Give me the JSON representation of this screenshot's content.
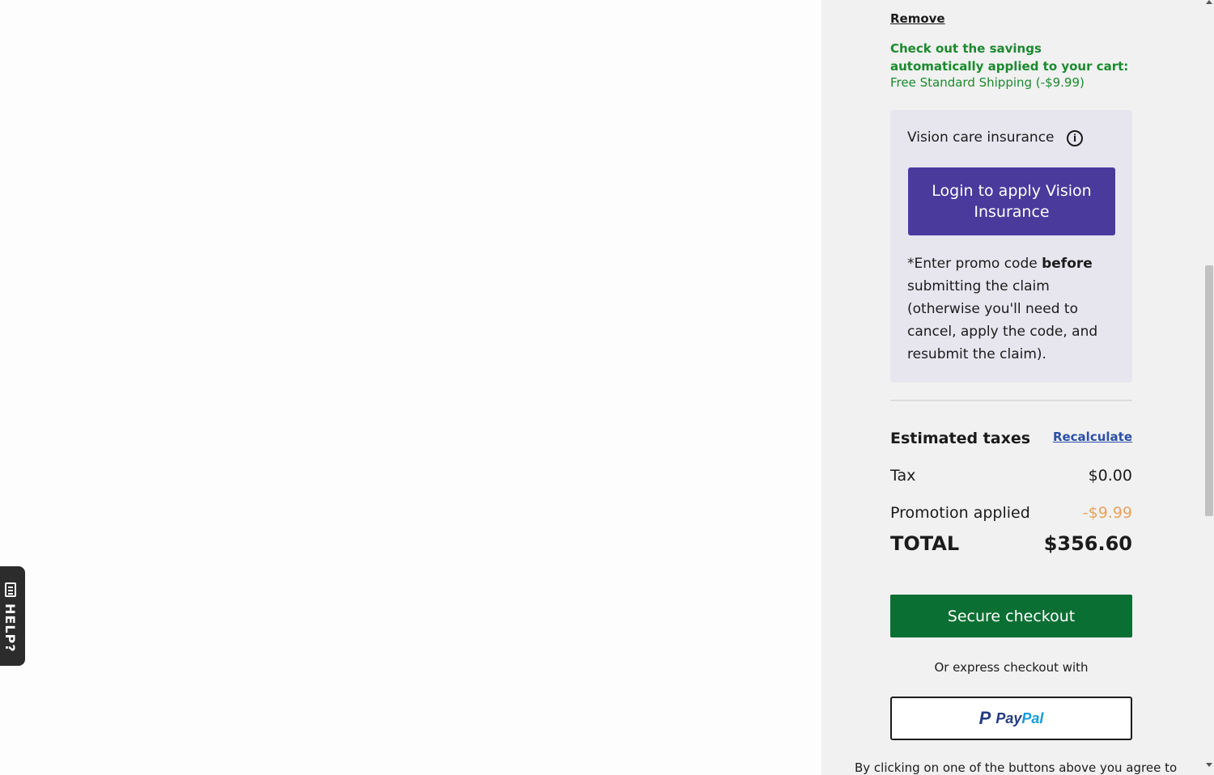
{
  "help_tab": {
    "label": "HELP?"
  },
  "cart_summary": {
    "remove_label": "Remove",
    "savings": {
      "title": "Check out the savings automatically applied to your cart:",
      "item": "Free Standard Shipping (-$9.99)"
    },
    "vision_insurance": {
      "title": "Vision care insurance",
      "login_button": "Login to apply Vision Insurance",
      "note_prefix": "*Enter promo code ",
      "note_bold": "before",
      "note_suffix": " submitting the claim (otherwise you'll need to cancel, apply the code, and resubmit the claim)."
    },
    "taxes": {
      "heading": "Estimated taxes",
      "recalculate_label": "Recalculate",
      "tax_label": "Tax",
      "tax_value": "$0.00",
      "promotion_label": "Promotion applied",
      "promotion_value": "-$9.99",
      "total_label": "TOTAL",
      "total_value": "$356.60"
    },
    "checkout": {
      "secure_checkout_label": "Secure checkout",
      "express_text": "Or express checkout with",
      "paypal_pay": "Pay",
      "paypal_pal": "Pal",
      "disclaimer": "By clicking on one of the buttons above you agree to"
    }
  },
  "colors": {
    "savings_green": "#1a8a2e",
    "login_purple": "#4a3a9c",
    "checkout_green": "#0a6f32",
    "promotion_orange": "#e9a35a",
    "link_blue": "#2b4fa8"
  }
}
